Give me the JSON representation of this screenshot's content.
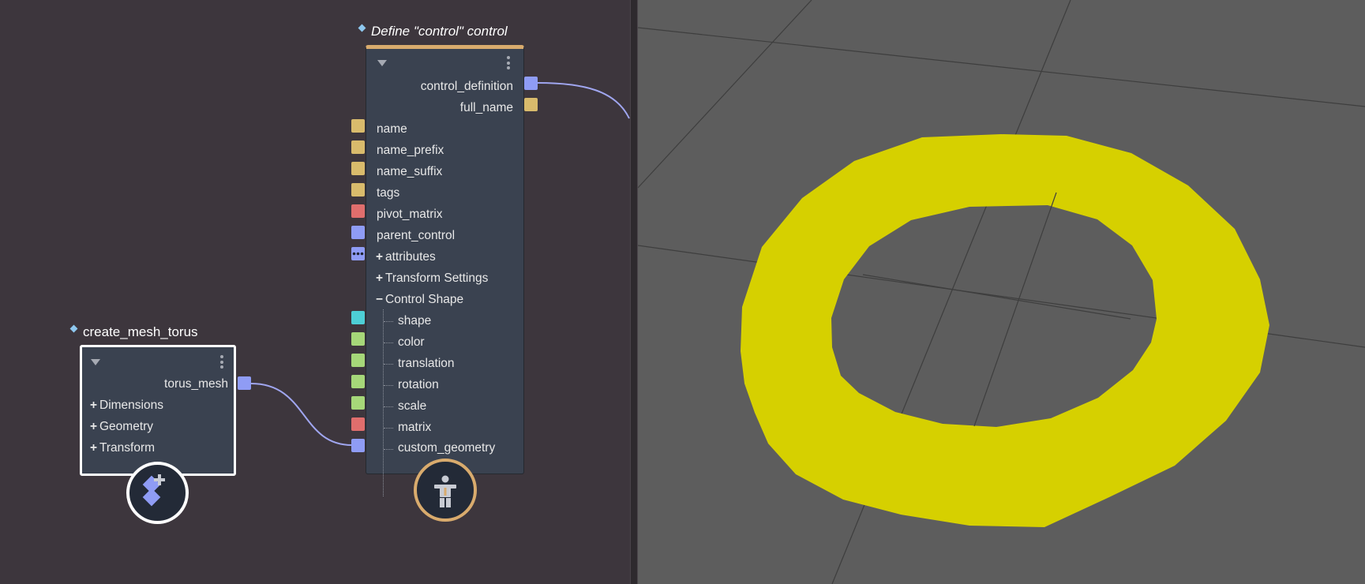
{
  "torus_node": {
    "title": "create_mesh_torus",
    "output_label": "torus_mesh",
    "groups": [
      {
        "sign": "+",
        "label": "Dimensions"
      },
      {
        "sign": "+",
        "label": "Geometry"
      },
      {
        "sign": "+",
        "label": "Transform"
      }
    ],
    "badge_icon": "mesh-add-icon"
  },
  "control_node": {
    "title": "Define \"control\" control",
    "outputs": [
      "control_definition",
      "full_name"
    ],
    "inputs": [
      "name",
      "name_prefix",
      "name_suffix",
      "tags",
      "pivot_matrix",
      "parent_control"
    ],
    "groups": [
      {
        "sign": "+",
        "label": "attributes"
      },
      {
        "sign": "+",
        "label": "Transform Settings"
      },
      {
        "sign": "−",
        "label": "Control Shape"
      }
    ],
    "shape_children": [
      "shape",
      "color",
      "translation",
      "rotation",
      "scale",
      "matrix",
      "custom_geometry"
    ],
    "badge_icon": "rig-figure-icon"
  },
  "colors": {
    "graph_background": "#3d363d",
    "node_body": "#3a4250",
    "node_accent": "#d9ab6d",
    "wire": "#a0a6f0",
    "port_blue": "#8f9cf5",
    "port_yellow": "#d9bb6c",
    "port_red": "#e06e6d",
    "port_cyan": "#4dcfd6",
    "port_green": "#a6d779",
    "viewport_background": "#5d5d5d",
    "torus_yellow": "#d6d000"
  }
}
